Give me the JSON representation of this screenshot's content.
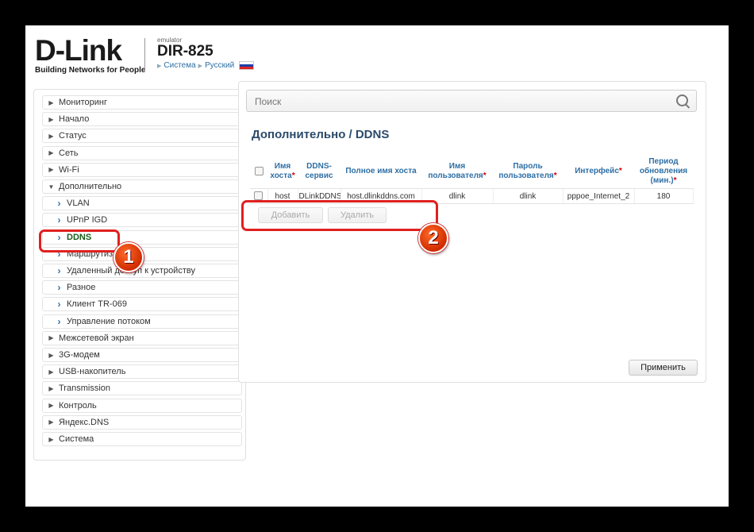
{
  "header": {
    "brand": "D-Link",
    "tagline": "Building Networks for People",
    "emulator": "emulator",
    "model": "DIR-825",
    "crumb_system": "Система",
    "crumb_lang": "Русский"
  },
  "sidebar": {
    "items": [
      {
        "label": "Мониторинг",
        "level": 0
      },
      {
        "label": "Начало",
        "level": 0
      },
      {
        "label": "Статус",
        "level": 0
      },
      {
        "label": "Сеть",
        "level": 0
      },
      {
        "label": "Wi-Fi",
        "level": 0
      },
      {
        "label": "Дополнительно",
        "level": 0,
        "expanded": true
      },
      {
        "label": "VLAN",
        "level": 1
      },
      {
        "label": "UPnP IGD",
        "level": 1
      },
      {
        "label": "DDNS",
        "level": 1,
        "active": true
      },
      {
        "label": "Маршрутизация",
        "level": 1
      },
      {
        "label": "Удаленный доступ к устройству",
        "level": 1
      },
      {
        "label": "Разное",
        "level": 1
      },
      {
        "label": "Клиент TR-069",
        "level": 1
      },
      {
        "label": "Управление потоком",
        "level": 1
      },
      {
        "label": "Межсетевой экран",
        "level": 0
      },
      {
        "label": "3G-модем",
        "level": 0
      },
      {
        "label": "USB-накопитель",
        "level": 0
      },
      {
        "label": "Transmission",
        "level": 0
      },
      {
        "label": "Контроль",
        "level": 0
      },
      {
        "label": "Яндекс.DNS",
        "level": 0
      },
      {
        "label": "Система",
        "level": 0
      }
    ]
  },
  "search": {
    "placeholder": "Поиск"
  },
  "page_title": "Дополнительно /  DDNS",
  "table": {
    "headers": [
      {
        "label": "Имя хоста",
        "req": "*"
      },
      {
        "label": "DDNS-сервис",
        "req": ""
      },
      {
        "label": "Полное имя хоста",
        "req": ""
      },
      {
        "label": "Имя пользователя",
        "req": "*"
      },
      {
        "label": "Пароль пользователя",
        "req": "*"
      },
      {
        "label": "Интерфейс",
        "req": "*"
      },
      {
        "label": "Период обновления (мин.)",
        "req": "*"
      }
    ],
    "rows": [
      [
        "host",
        "DLinkDDNS",
        "host.dlinkddns.com",
        "dlink",
        "dlink",
        "pppoe_Internet_2",
        "180"
      ]
    ]
  },
  "buttons": {
    "add": "Добавить",
    "delete": "Удалить",
    "apply": "Применить"
  },
  "annotations": {
    "marker1": "1",
    "marker2": "2"
  },
  "colors": {
    "annotation": "#e02020",
    "marker": "#e04010",
    "active_nav": "#1a5d1a",
    "link": "#2e6fa5"
  }
}
